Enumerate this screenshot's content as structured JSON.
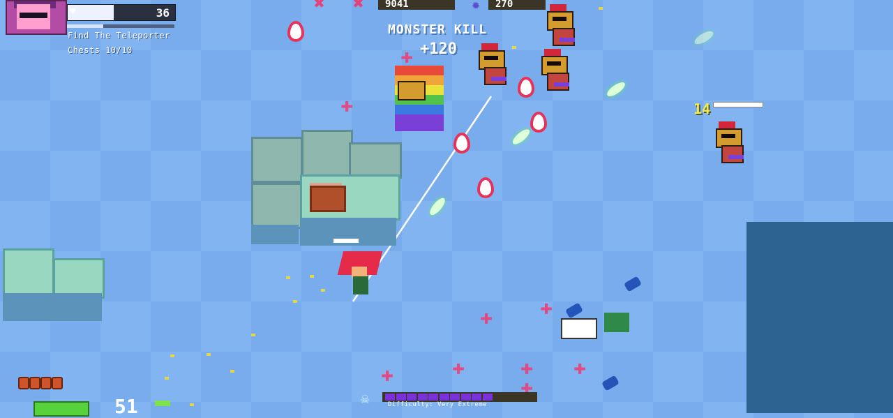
{
  "hud": {
    "portrait": "player-portrait",
    "health": {
      "value": "36",
      "fill_fraction": 0.43
    },
    "xp_fill_fraction": 0.34,
    "objective": "Find The Teleporter",
    "chests": "Chests 10/10",
    "counter_left": "9041",
    "counter_right": "270"
  },
  "popup": {
    "title": "MONSTER KILL",
    "score": "+120"
  },
  "enemy_hp": {
    "damage": "14",
    "fill_fraction": 0.95
  },
  "bottom_hud": {
    "difficulty_label": "Difficulty: Very Extreme",
    "difficulty_segments": 10,
    "difficulty_total": 14,
    "ammo_reserve_pips": 4,
    "ammo_count": "51"
  },
  "colors": {
    "background": "#83b4f2",
    "accent_pink": "#e24a83",
    "difficulty": "#7a32d8",
    "weapon": "#58d23a"
  },
  "icons": {
    "heart": "heart-icon",
    "skull": "skull-icon",
    "star": "star-icon",
    "weapon": "weapon-icon"
  }
}
